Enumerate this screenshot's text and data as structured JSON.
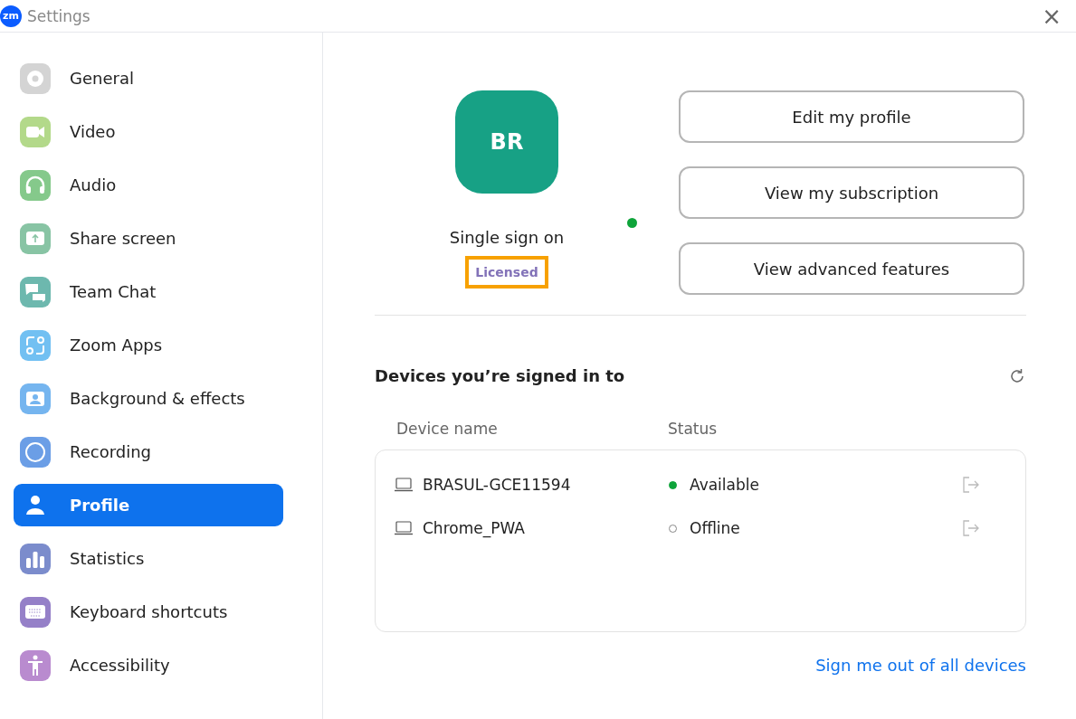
{
  "window": {
    "logo": "zm",
    "title": "Settings",
    "close": "×"
  },
  "sidebar": {
    "items": [
      {
        "label": "General",
        "color": "#d4d4d4",
        "selected": false
      },
      {
        "label": "Video",
        "color": "#b3d98a",
        "selected": false
      },
      {
        "label": "Audio",
        "color": "#85c98b",
        "selected": false
      },
      {
        "label": "Share screen",
        "color": "#88c4a4",
        "selected": false
      },
      {
        "label": "Team Chat",
        "color": "#6db8ae",
        "selected": false
      },
      {
        "label": "Zoom Apps",
        "color": "#72c0f2",
        "selected": false
      },
      {
        "label": "Background & effects",
        "color": "#75b5ef",
        "selected": false
      },
      {
        "label": "Recording",
        "color": "#6b9ee6",
        "selected": false
      },
      {
        "label": "Profile",
        "selected": true
      },
      {
        "label": "Statistics",
        "color": "#7b8ccc",
        "selected": false
      },
      {
        "label": "Keyboard shortcuts",
        "color": "#9580c8",
        "selected": false
      },
      {
        "label": "Accessibility",
        "color": "#b98bcf",
        "selected": false
      }
    ]
  },
  "profile": {
    "initials": "BR",
    "online": true,
    "account_type": "Single sign on",
    "license": "Licensed",
    "highlighted": true
  },
  "buttons": [
    "Edit my profile",
    "View my subscription",
    "View advanced features"
  ],
  "devices": {
    "title": "Devices you’re signed in to",
    "columns": [
      "Device name",
      "Status"
    ],
    "rows": [
      {
        "name": "BRASUL-GCE11594",
        "status": "Available",
        "online": true
      },
      {
        "name": "Chrome_PWA",
        "status": "Offline",
        "online": false
      }
    ],
    "sign_out_all": "Sign me out of all devices"
  }
}
